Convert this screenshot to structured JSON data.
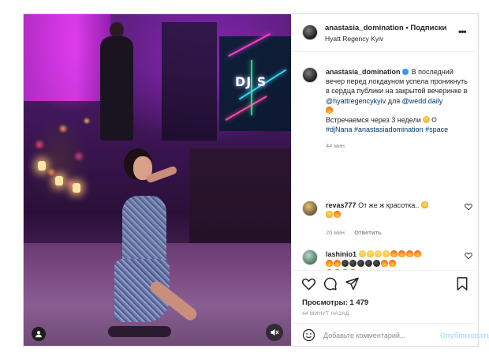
{
  "post": {
    "username": "anastasia_domination",
    "follow_label": "• Подписки",
    "location": "Hyatt Regency Kyiv",
    "more_label": "•••"
  },
  "media": {
    "screen_text": "DJ S"
  },
  "caption": {
    "username": "anastasia_domination",
    "line1": "В последний вечер перед локдауном успела проникнуть в сердца публики на закрытой вечеринке в",
    "mention1": "@hyattregencykyiv",
    "for_word": "для",
    "mention2": "@wedd.daily",
    "line2": "Встречаемся через 3 недели",
    "hashtags": "#djNana #anastasiadomination #space",
    "time": "44 мин."
  },
  "comments": [
    {
      "username": "revas777",
      "text": "От же ж красотка..",
      "time": "26 мин.",
      "reply_label": "Ответить"
    },
    {
      "username": "lashinio1",
      "text": ""
    }
  ],
  "actions": {
    "likes": "Просмотры: 1 479",
    "ago": "44 МИНУТ НАЗАД"
  },
  "add_comment": {
    "placeholder": "Добавьте комментарий...",
    "publish_label": "Опубликовать"
  },
  "icons": {
    "like": "heart-icon",
    "comment": "comment-icon",
    "share": "share-icon",
    "save": "bookmark-icon",
    "emoji": "emoji-icon",
    "mute": "mute-icon",
    "user_tag": "user-tag-icon"
  }
}
